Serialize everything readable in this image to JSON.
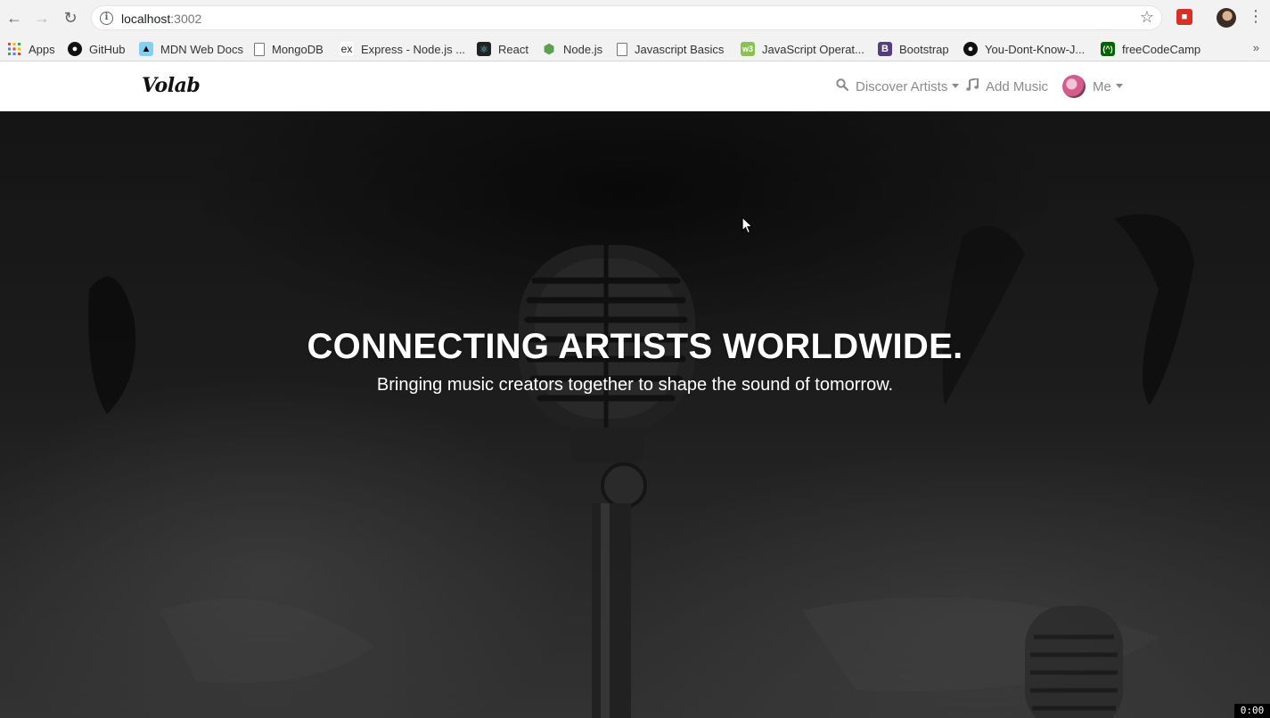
{
  "browser": {
    "url_host": "localhost",
    "url_port": ":3002",
    "bookmarks": [
      {
        "label": "Apps",
        "icon": "apps-grid-icon"
      },
      {
        "label": "GitHub",
        "icon": "github-icon"
      },
      {
        "label": "MDN Web Docs",
        "icon": "mdn-icon"
      },
      {
        "label": "MongoDB",
        "icon": "page-icon"
      },
      {
        "label": "Express - Node.js ...",
        "icon": "express-icon"
      },
      {
        "label": "React",
        "icon": "react-icon"
      },
      {
        "label": "Node.js",
        "icon": "nodejs-icon"
      },
      {
        "label": "Javascript Basics",
        "icon": "page-icon"
      },
      {
        "label": "JavaScript Operat...",
        "icon": "w3-icon"
      },
      {
        "label": "Bootstrap",
        "icon": "bootstrap-icon"
      },
      {
        "label": "You-Dont-Know-J...",
        "icon": "github-icon"
      },
      {
        "label": "freeCodeCamp",
        "icon": "freecodecamp-icon"
      }
    ],
    "more": "»"
  },
  "navbar": {
    "brand": "Volab",
    "discover_label": "Discover Artists",
    "add_music_label": "Add Music",
    "me_label": "Me"
  },
  "hero": {
    "title": "CONNECTING ARTISTS WORLDWIDE.",
    "subtitle": "Bringing music creators together to shape the sound of tomorrow."
  },
  "timer": "0:00",
  "colors": {
    "nav_text": "#8a8a8a",
    "hero_text": "#ffffff",
    "chrome_bg": "#f2f2f2"
  }
}
